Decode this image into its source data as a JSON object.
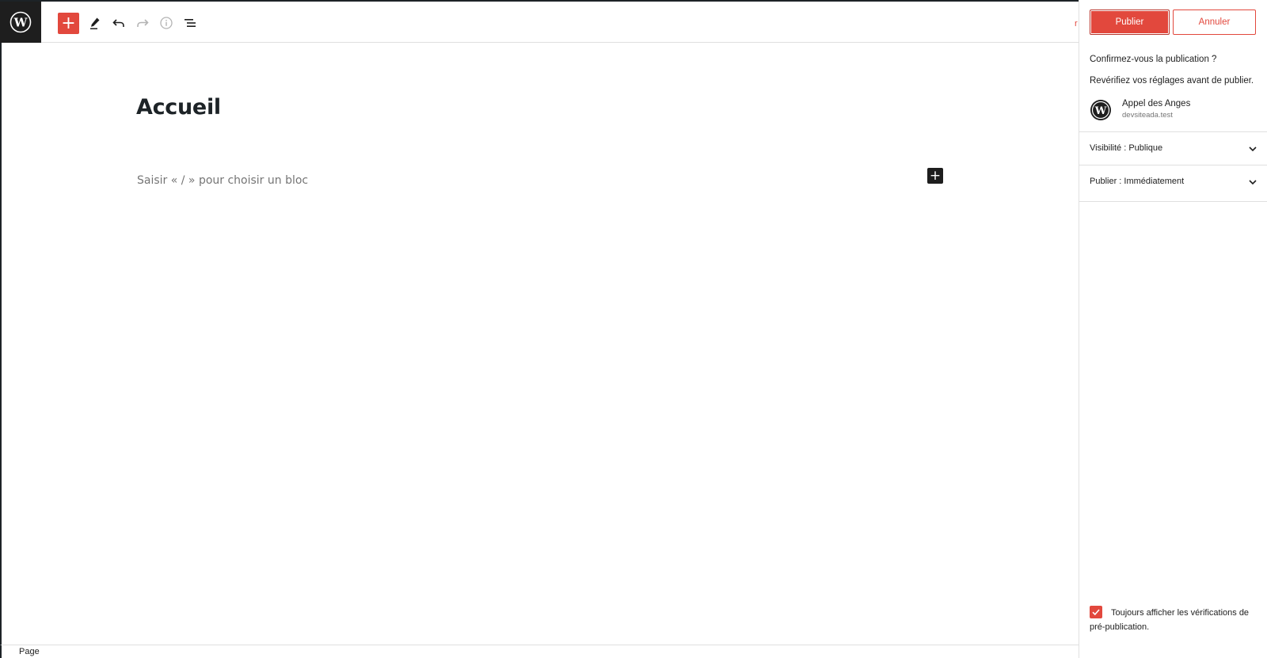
{
  "toolbar": {
    "logo_icon": "wordpress-icon",
    "add_block_icon": "plus-icon",
    "tools_icon": "pencil-icon",
    "undo_icon": "undo-icon",
    "redo_icon": "redo-icon",
    "details_icon": "info-icon",
    "list_view_icon": "list-view-icon",
    "accent_color": "#e2483d"
  },
  "editor": {
    "title": "Accueil",
    "block_placeholder": "Saisir « / » pour choisir un bloc",
    "inline_add_icon": "plus-icon"
  },
  "footer": {
    "breadcrumb": "Page"
  },
  "publish_panel": {
    "publish_label": "Publier",
    "cancel_label": "Annuler",
    "confirm_text": "Confirmez-vous la publication ?",
    "review_text": "Revérifiez vos réglages avant de publier.",
    "site_name": "Appel des Anges",
    "site_url": "devsiteada.test",
    "visibility_label": "Visibilité : Publique",
    "schedule_label": "Publier : Immédiatement",
    "always_show_checks": "Toujours afficher les vérifications de pré-publication.",
    "always_show_checked": true
  }
}
